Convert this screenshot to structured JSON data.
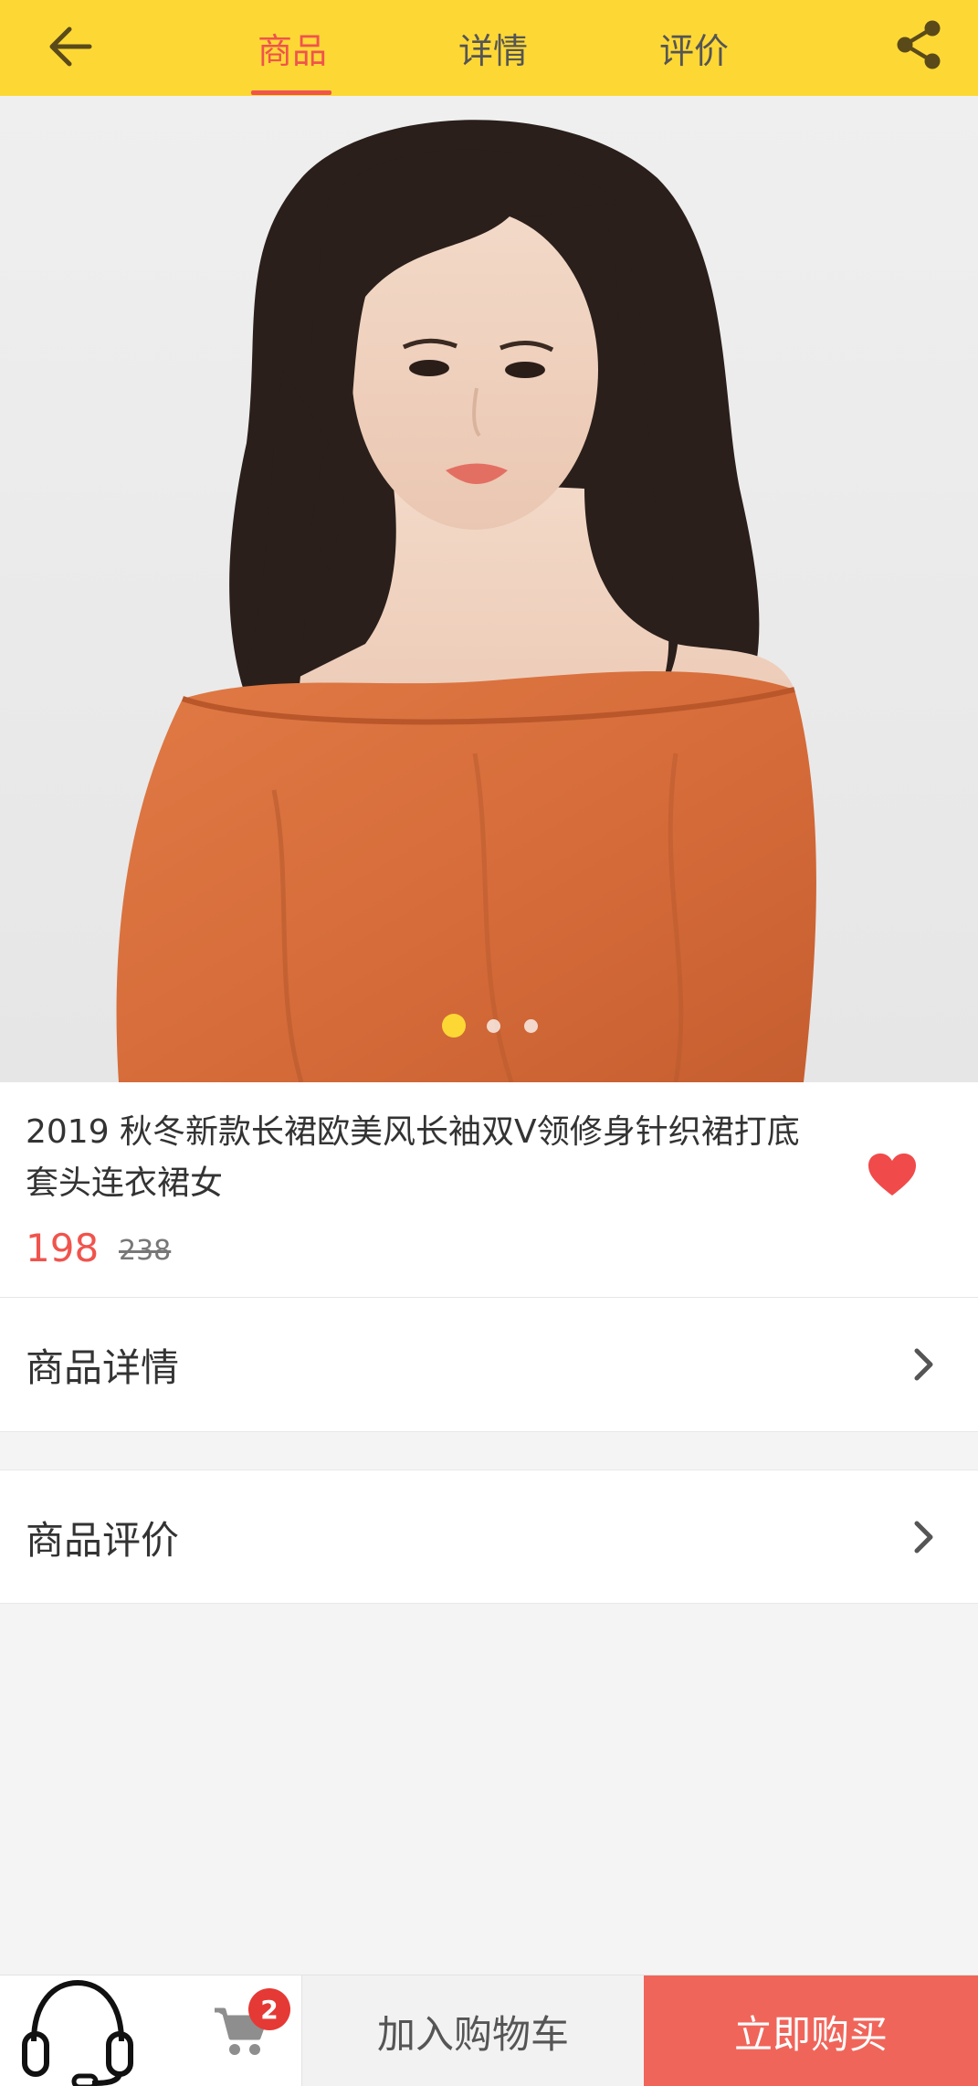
{
  "header": {
    "tabs": [
      {
        "label": "商品",
        "active": true
      },
      {
        "label": "详情",
        "active": false
      },
      {
        "label": "评价",
        "active": false
      }
    ],
    "back_icon": "arrow-left-icon",
    "share_icon": "share-icon",
    "accent_color": "#fdd835",
    "active_color": "#f0544d"
  },
  "carousel": {
    "image": "product-photo",
    "total_slides": 3,
    "active_slide": 1
  },
  "product": {
    "title": "2019 秋冬新款长裙欧美风长袖双V领修身针织裙打底套头连衣裙女",
    "price": "198",
    "original_price": "238",
    "favorite_icon": "heart-icon",
    "favorite_color": "#f04a4a"
  },
  "links": {
    "detail_label": "商品详情",
    "review_label": "商品评价"
  },
  "bottom_bar": {
    "service_icon": "headset-icon",
    "cart_icon": "cart-icon",
    "cart_count": "2",
    "add_to_cart_label": "加入购物车",
    "buy_now_label": "立即购买",
    "buy_color": "#f0655a"
  }
}
